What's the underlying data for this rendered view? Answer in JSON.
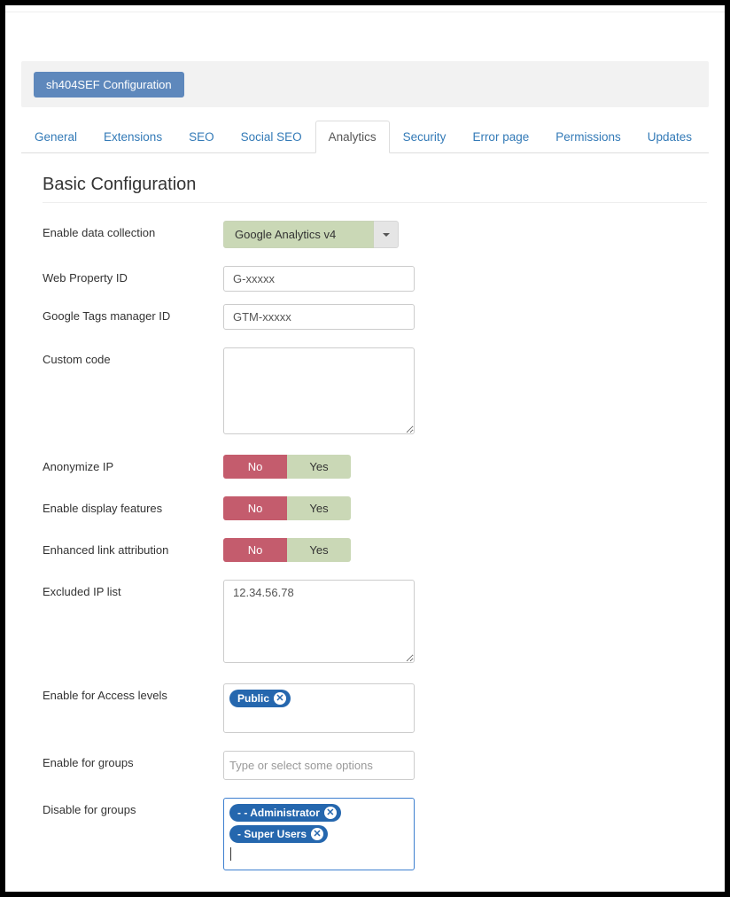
{
  "header": {
    "config_button": "sh404SEF Configuration"
  },
  "tabs": [
    {
      "label": "General",
      "active": false
    },
    {
      "label": "Extensions",
      "active": false
    },
    {
      "label": "SEO",
      "active": false
    },
    {
      "label": "Social SEO",
      "active": false
    },
    {
      "label": "Analytics",
      "active": true
    },
    {
      "label": "Security",
      "active": false
    },
    {
      "label": "Error page",
      "active": false
    },
    {
      "label": "Permissions",
      "active": false
    },
    {
      "label": "Updates",
      "active": false
    }
  ],
  "section": {
    "title": "Basic Configuration"
  },
  "fields": {
    "enable_collection": {
      "label": "Enable data collection",
      "value": "Google Analytics v4"
    },
    "web_property": {
      "label": "Web Property ID",
      "value": "G-xxxxx"
    },
    "gtm_id": {
      "label": "Google Tags manager ID",
      "value": "GTM-xxxxx"
    },
    "custom_code": {
      "label": "Custom code",
      "value": ""
    },
    "anonymize_ip": {
      "label": "Anonymize IP",
      "no": "No",
      "yes": "Yes",
      "selected": "no"
    },
    "display_features": {
      "label": "Enable display features",
      "no": "No",
      "yes": "Yes",
      "selected": "no"
    },
    "enhanced_link": {
      "label": "Enhanced link attribution",
      "no": "No",
      "yes": "Yes",
      "selected": "no"
    },
    "excluded_ip": {
      "label": "Excluded IP list",
      "value": "12.34.56.78"
    },
    "enable_access": {
      "label": "Enable for Access levels",
      "tags": [
        "Public"
      ]
    },
    "enable_groups": {
      "label": "Enable for groups",
      "placeholder": "Type or select some options"
    },
    "disable_groups": {
      "label": "Disable for groups",
      "tags": [
        "- - Administrator",
        "- Super Users"
      ]
    }
  }
}
